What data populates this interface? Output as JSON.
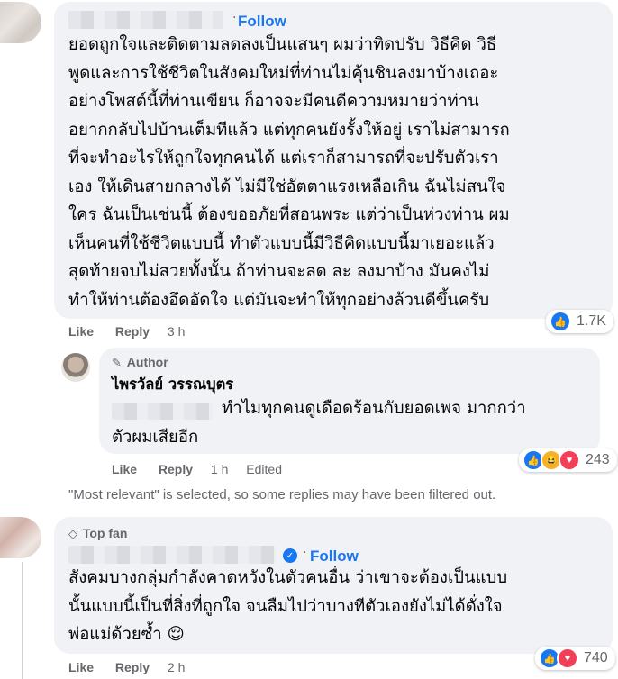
{
  "comments": [
    {
      "follow_label": "Follow",
      "text": "ยอดถูกใจและติดตามลดลงเป็นแสนๆ ผมว่าทิดปรับ วิธีคิด วิธี\nพูดและการใช้ชีวิตในสังคมใหม่ที่ท่านไม่คุ้นชินลงมาบ้างเถอะ\nอย่างโพสต์นี้ที่ท่านเขียน ก็อาจจะมีคนดีความหมายว่าท่าน\nอยากกลับไปบ้านเต็มทีแล้ว แต่ทุกคนยังรั้งให้อยู่ เราไม่สามารถ\nที่จะทำอะไรให้ถูกใจทุกคนได้ แต่เราก็สามารถที่จะปรับตัวเรา\nเอง ให้เดินสายกลางได้ ไม่มีใช่อัตตาแรงเหลือเกิน ฉันไม่สนใจ\nใคร ฉันเป็นเช่นนี้ ต้องขออภัยที่สอนพระ แต่ว่าเป็นห่วงท่าน ผม\nเห็นคนที่ใช้ชีวิตแบบนี้ ทำตัวแบบนี้มีวิธีคิดแบบนี้มาเยอะแล้ว\nสุดท้ายจบไม่สวยทั้งนั้น ถ้าท่านจะลด ละ ลงมาบ้าง มันคงไม่\nทำให้ท่านต้องอึดอัดใจ แต่มันจะทำให้ทุกอย่างล้วนดีขึ้นครับ",
      "like_label": "Like",
      "reply_label": "Reply",
      "time": "3 h",
      "reaction_count": "1.7K"
    },
    {
      "author_badge": "Author",
      "name": "ไพรวัลย์ วรรณบุตร",
      "text": "ทำไมทุกคนดูเดือดร้อนกับยอดเพจ มากกว่า\nตัวผมเสียอีก",
      "like_label": "Like",
      "reply_label": "Reply",
      "time": "1 h",
      "edited_label": "Edited",
      "reaction_count": "243"
    },
    {
      "top_fan_label": "Top fan",
      "follow_label": "Follow",
      "text": "สังคมบางกลุ่มกำลังคาดหวังในตัวคนอื่น ว่าเขาจะต้องเป็นแบบ\nนั้นแบบนี้เป็นที่สิ่งที่ถูกใจ จนลืมไปว่าบางทีตัวเองยังไม่ได้ดั่งใจ\nพ่อแม่ด้วยซ้ำ 😌",
      "like_label": "Like",
      "reply_label": "Reply",
      "time": "2 h",
      "reaction_count": "740"
    }
  ],
  "filter_notice": "\"Most relevant\" is selected, so some replies may have been filtered out.",
  "colors": {
    "link_blue": "#1877f2",
    "bubble_bg": "#f0f2f5",
    "meta_gray": "#65676b",
    "like_blue": "#1877f2",
    "love_red": "#f33e58",
    "haha_yellow": "#f7b125"
  },
  "icons": [
    "like-reaction-icon",
    "haha-reaction-icon",
    "love-reaction-icon",
    "pencil-icon",
    "diamond-icon",
    "verified-badge-icon"
  ]
}
